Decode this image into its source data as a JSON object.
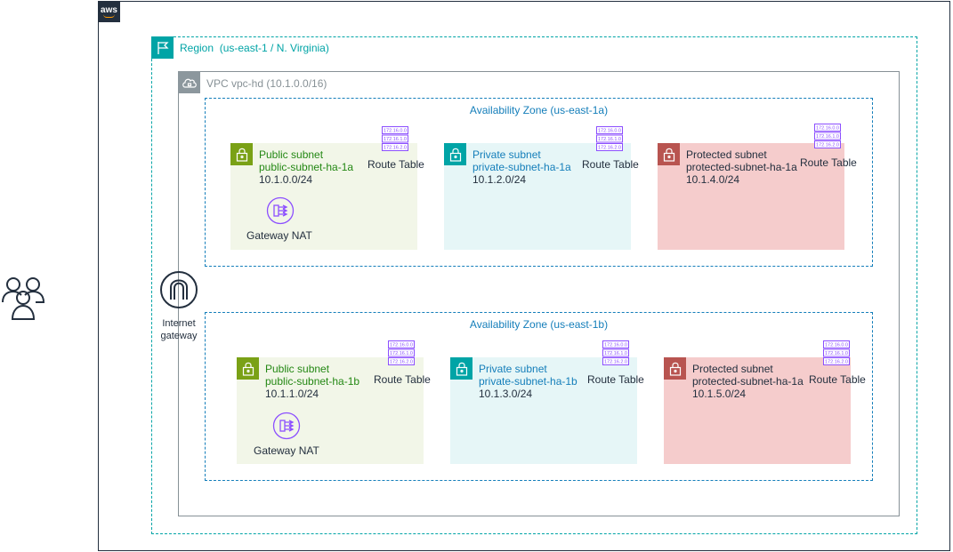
{
  "aws_logo": "aws",
  "region": {
    "label": "Region  (us-east-1 / N. Virginia)"
  },
  "vpc": {
    "label": "VPC vpc-hd (10.1.0.0/16)"
  },
  "internet_gateway": {
    "line1": "Internet",
    "line2": "gateway"
  },
  "route_table_label": "Route Table",
  "route_table_entries": [
    "172.16.0.0",
    "172.16.1.0",
    "172.16.2.0"
  ],
  "nat_label": "Gateway NAT",
  "zones": [
    {
      "label": "Availability Zone (us-east-1a)",
      "public": {
        "type": "Public subnet",
        "name": "public-subnet-ha-1a",
        "cidr": "10.1.0.0/24"
      },
      "private": {
        "type": "Private subnet",
        "name": "private-subnet-ha-1a",
        "cidr": "10.1.2.0/24"
      },
      "protected": {
        "type": "Protected subnet",
        "name": "protected-subnet-ha-1a",
        "cidr": "10.1.4.0/24"
      }
    },
    {
      "label": "Availability Zone (us-east-1b)",
      "public": {
        "type": "Public subnet",
        "name": "public-subnet-ha-1b",
        "cidr": "10.1.1.0/24"
      },
      "private": {
        "type": "Private subnet",
        "name": "private-subnet-ha-1b",
        "cidr": "10.1.3.0/24"
      },
      "protected": {
        "type": "Protected subnet",
        "name": "protected-subnet-ha-1a",
        "cidr": "10.1.5.0/24"
      }
    }
  ],
  "colors": {
    "region": "#00a4a6",
    "az": "#147eba",
    "public_subnet": "#7aa116",
    "private_subnet": "#00a4a6",
    "protected_subnet": "#b85450",
    "route_table": "#8c4fff",
    "nat": "#8c4fff"
  }
}
